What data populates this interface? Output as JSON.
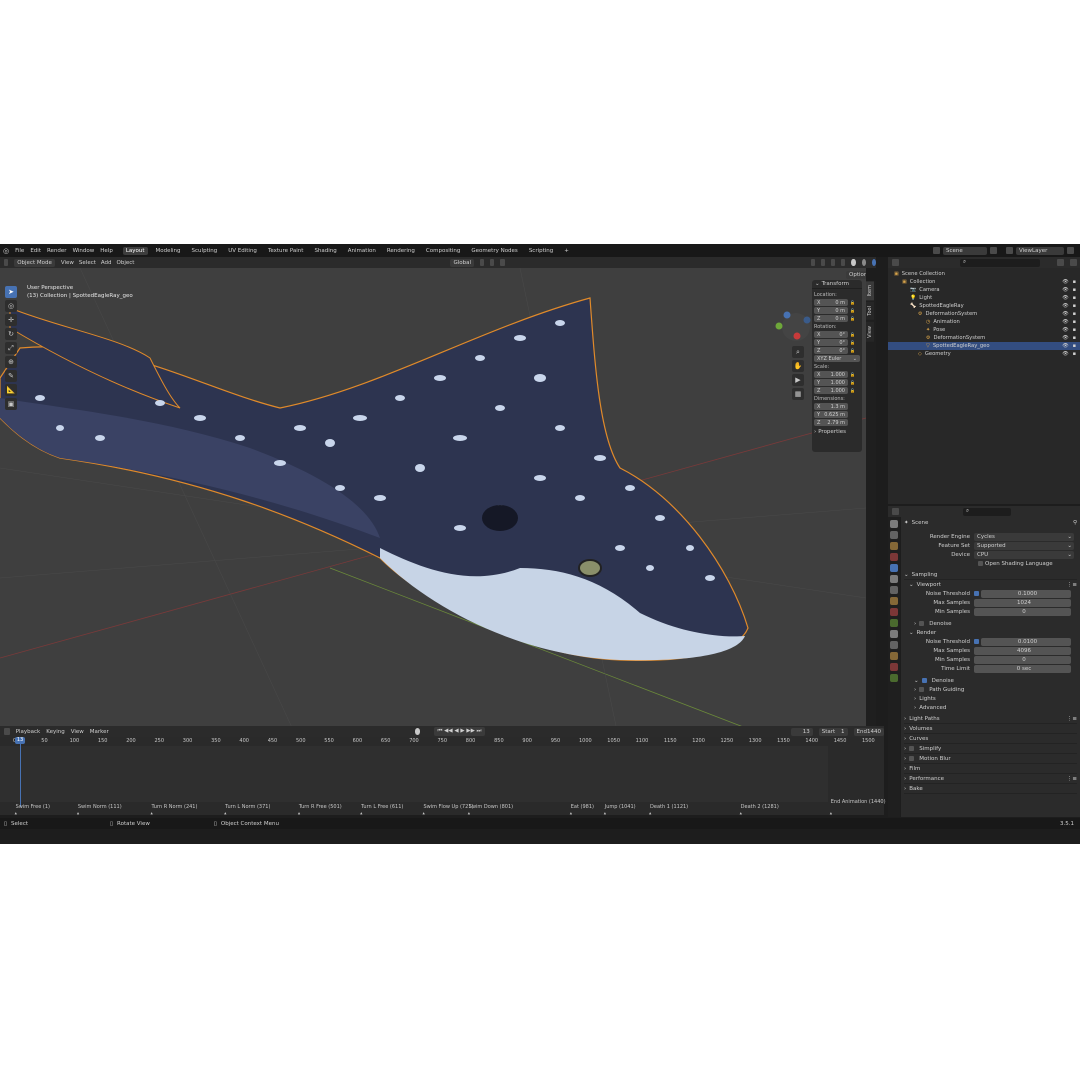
{
  "topbar": {
    "menus": [
      "File",
      "Edit",
      "Render",
      "Window",
      "Help"
    ],
    "workspaces": [
      "Layout",
      "Modeling",
      "Sculpting",
      "UV Editing",
      "Texture Paint",
      "Shading",
      "Animation",
      "Rendering",
      "Compositing",
      "Geometry Nodes",
      "Scripting",
      "+"
    ],
    "active_workspace": "Layout",
    "scene": "Scene",
    "view_layer": "ViewLayer"
  },
  "viewport": {
    "mode": "Object Mode",
    "menus": [
      "View",
      "Select",
      "Add",
      "Object"
    ],
    "transform_orientation": "Global",
    "options": "Options",
    "info_line1": "User Perspective",
    "info_line2": "(13) Collection | SpottedEagleRay_geo"
  },
  "npanel": {
    "tabs": [
      "Item",
      "Tool",
      "View"
    ],
    "header": "Transform",
    "location_label": "Location:",
    "location": [
      {
        "axis": "X",
        "value": "0 m"
      },
      {
        "axis": "Y",
        "value": "0 m"
      },
      {
        "axis": "Z",
        "value": "0 m"
      }
    ],
    "rotation_label": "Rotation:",
    "rotation": [
      {
        "axis": "X",
        "value": "0°"
      },
      {
        "axis": "Y",
        "value": "0°"
      },
      {
        "axis": "Z",
        "value": "0°"
      }
    ],
    "rotation_mode": "XYZ Euler",
    "scale_label": "Scale:",
    "scale": [
      {
        "axis": "X",
        "value": "1.000"
      },
      {
        "axis": "Y",
        "value": "1.000"
      },
      {
        "axis": "Z",
        "value": "1.000"
      }
    ],
    "dimensions_label": "Dimensions:",
    "dimensions": [
      {
        "axis": "X",
        "value": "1.3 m"
      },
      {
        "axis": "Y",
        "value": "0.625 m"
      },
      {
        "axis": "Z",
        "value": "2.79 m"
      }
    ],
    "properties": "Properties"
  },
  "outliner": {
    "items": [
      {
        "label": "Scene Collection",
        "indent": 0
      },
      {
        "label": "Collection",
        "indent": 1
      },
      {
        "label": "Camera",
        "indent": 2
      },
      {
        "label": "Light",
        "indent": 2
      },
      {
        "label": "SpottedEagleRay",
        "indent": 2
      },
      {
        "label": "DeformationSystem",
        "indent": 3
      },
      {
        "label": "Animation",
        "indent": 4
      },
      {
        "label": "Pose",
        "indent": 4
      },
      {
        "label": "DeformationSystem",
        "indent": 4
      },
      {
        "label": "SpottedEagleRay_geo",
        "indent": 4
      },
      {
        "label": "Geometry",
        "indent": 3
      }
    ]
  },
  "properties": {
    "context": "Scene",
    "render_engine_label": "Render Engine",
    "render_engine": "Cycles",
    "feature_set_label": "Feature Set",
    "feature_set": "Supported",
    "device_label": "Device",
    "device": "CPU",
    "osl": "Open Shading Language",
    "sampling": "Sampling",
    "viewport": "Viewport",
    "noise_threshold_label": "Noise Threshold",
    "vp_noise_threshold": "0.1000",
    "max_samples_label": "Max Samples",
    "vp_max_samples": "1024",
    "min_samples_label": "Min Samples",
    "vp_min_samples": "0",
    "denoise": "Denoise",
    "render": "Render",
    "r_noise_threshold": "0.0100",
    "r_max_samples": "4096",
    "r_min_samples": "0",
    "time_limit_label": "Time Limit",
    "r_time_limit": "0 sec",
    "path_guiding": "Path Guiding",
    "lights": "Lights",
    "advanced": "Advanced",
    "sections": [
      "Light Paths",
      "Volumes",
      "Curves",
      "Simplify",
      "Motion Blur",
      "Film",
      "Performance",
      "Bake"
    ]
  },
  "timeline": {
    "menus": [
      "Playback",
      "Keying",
      "View",
      "Marker"
    ],
    "current_frame": "13",
    "start_label": "Start",
    "start": "1",
    "end_label": "End",
    "end": "1440",
    "ticks": [
      "0",
      "50",
      "100",
      "150",
      "200",
      "250",
      "300",
      "350",
      "400",
      "450",
      "500",
      "550",
      "600",
      "650",
      "700",
      "750",
      "800",
      "850",
      "900",
      "950",
      "1000",
      "1050",
      "1100",
      "1150",
      "1200",
      "1250",
      "1300",
      "1350",
      "1400",
      "1450",
      "1500"
    ],
    "markers": [
      "Swim Free (1)",
      "Swim Norm (111)",
      "Turn R Norm (241)",
      "Turn L Norm (371)",
      "Turn R Free (501)",
      "Turn L Free (611)",
      "Swim Flow Up (721)",
      "Swim Down (801)",
      "Eat (981)",
      "Jump (1041)",
      "Death 1 (1121)",
      "Death 2 (1281)",
      "End Animation (1440)"
    ]
  },
  "statusbar": {
    "select": "Select",
    "rotate": "Rotate View",
    "context_menu": "Object Context Menu",
    "version": "3.5.1"
  }
}
